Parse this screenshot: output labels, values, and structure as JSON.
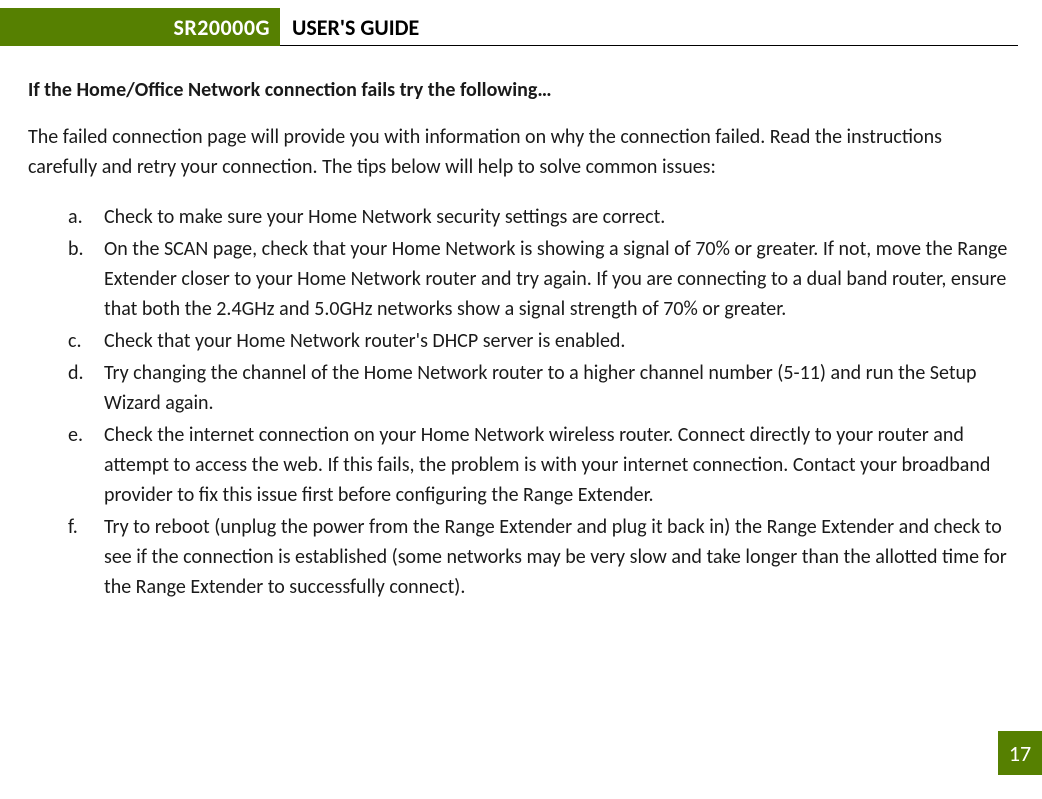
{
  "header": {
    "product": "SR20000G",
    "title": "USER'S GUIDE"
  },
  "section": {
    "heading": "If the Home/Office Network connection fails try the following…",
    "intro": "The failed connection page will provide you with information on why the connection failed. Read the instructions carefully and retry your connection. The tips below will help to solve common issues:"
  },
  "steps": [
    {
      "marker": "a.",
      "text": "Check to make sure your Home Network security settings are correct."
    },
    {
      "marker": "b.",
      "text": "On the SCAN page, check that your Home Network is showing a signal of 70% or greater. If not, move the Range Extender closer to your Home Network router and try again. If you are connecting to a dual band router, ensure that both the 2.4GHz and 5.0GHz networks show a signal strength of 70% or greater."
    },
    {
      "marker": "c.",
      "text": "Check that your Home Network router's DHCP server is enabled."
    },
    {
      "marker": "d.",
      "text": "Try changing the channel of the Home Network router to a higher channel number (5-11) and run the Setup Wizard again."
    },
    {
      "marker": "e.",
      "text": "Check the internet connection on your Home Network wireless router. Connect directly to your router and attempt to access the web.  If this fails, the problem is with your internet connection.  Contact your broadband provider to fix this issue first before configuring the Range Extender."
    },
    {
      "marker": "f.",
      "text": "Try to reboot (unplug the power from the Range Extender and plug it back in) the Range Extender and check to see if the connection is established (some networks may be very slow and take longer than the allotted time for the Range Extender to successfully connect)."
    }
  ],
  "page_number": "17"
}
